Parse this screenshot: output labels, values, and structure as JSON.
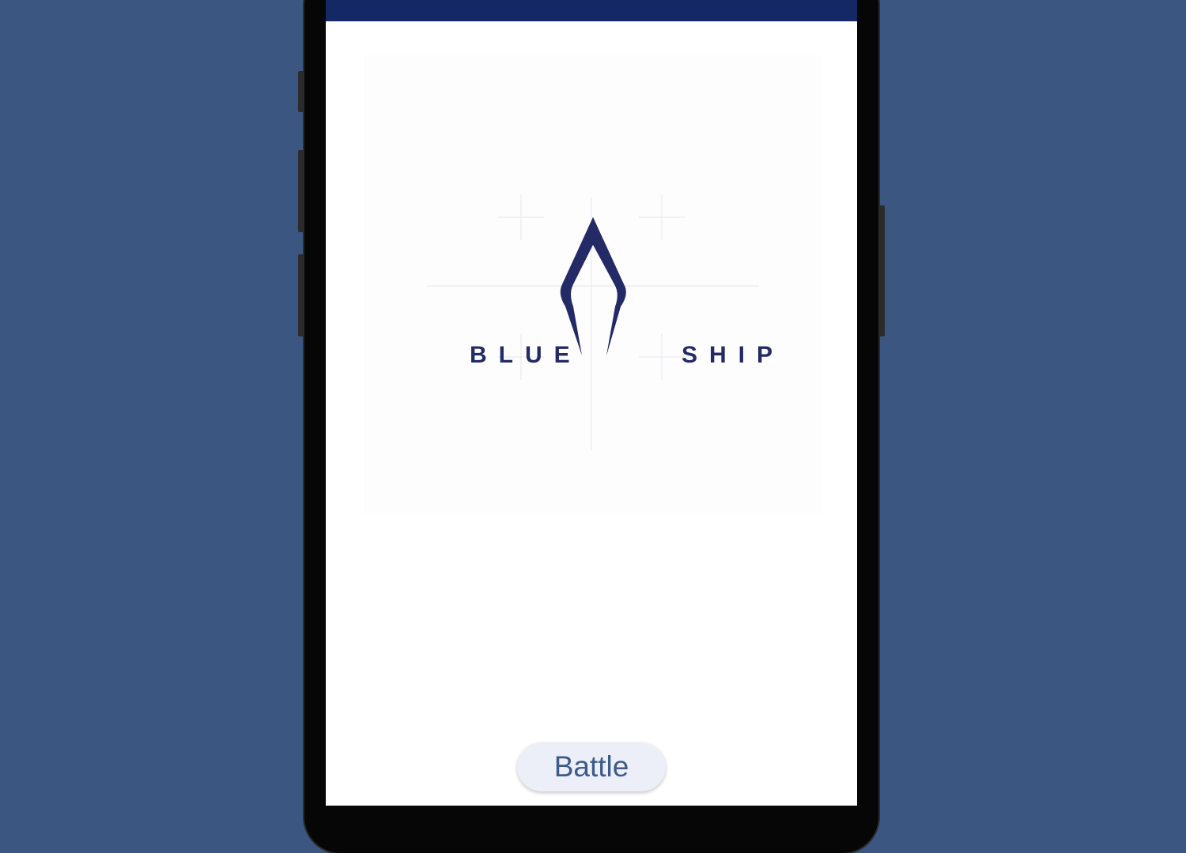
{
  "app": {
    "logo": {
      "word_left": "BLUE",
      "word_right": "SHIP",
      "color": "#232a66"
    },
    "battle_button_label": "Battle"
  },
  "colors": {
    "background": "#3b5781",
    "status_bar": "#132864",
    "screen": "#ffffff",
    "button_bg": "#eceef8",
    "button_text": "#3d5a8a"
  },
  "icons": {
    "logo_mark": "ship-bow-icon"
  }
}
